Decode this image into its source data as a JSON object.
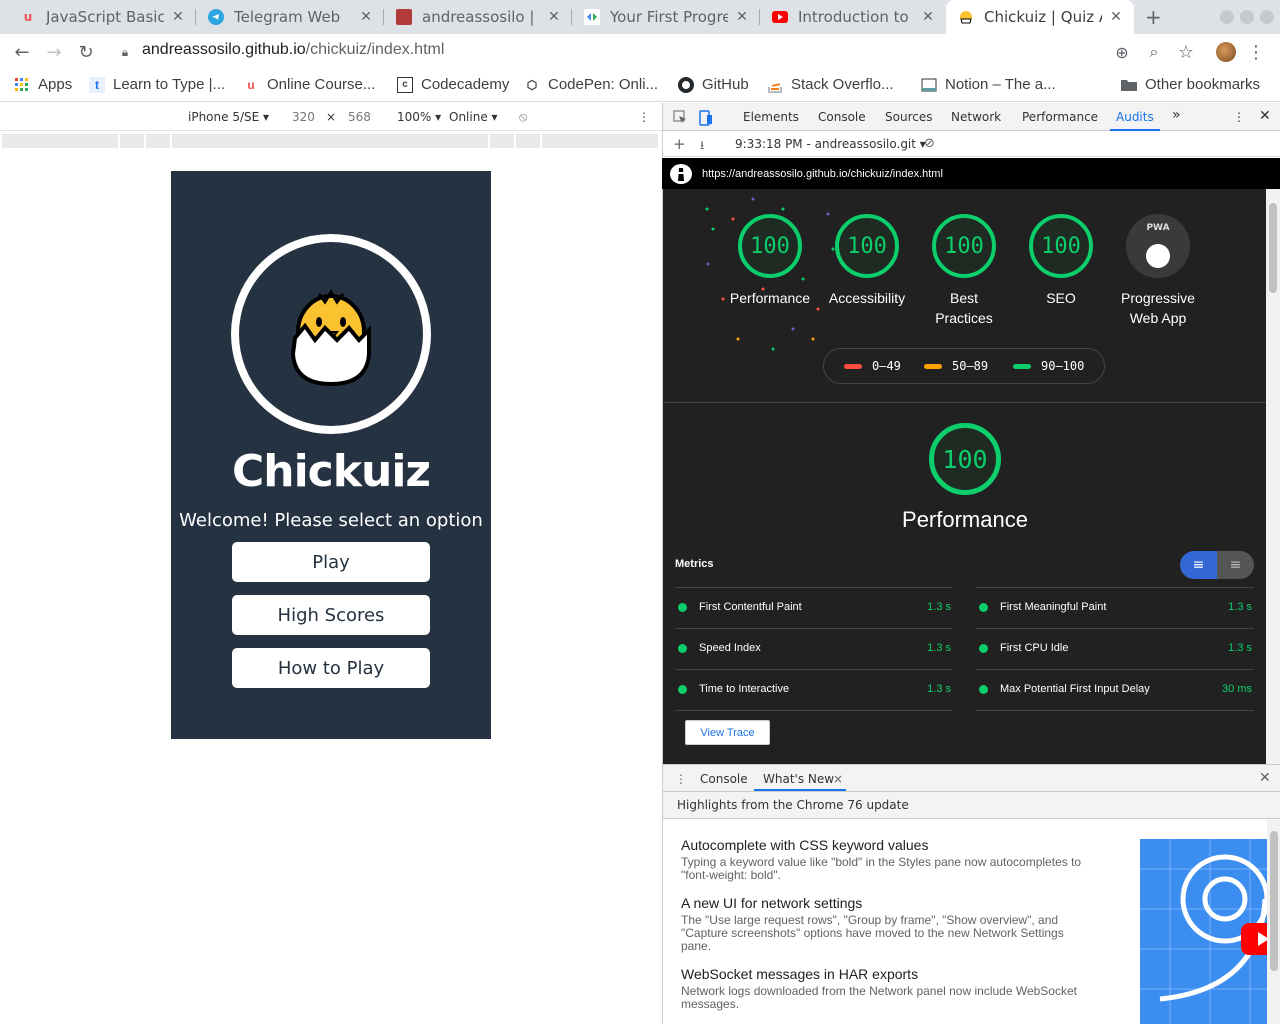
{
  "tabs": [
    {
      "label": "JavaScript Basics",
      "icon": "udemy-icon"
    },
    {
      "label": "Telegram Web",
      "icon": "telegram-icon"
    },
    {
      "label": "andreassosilo | Co",
      "icon": "scrimba-icon"
    },
    {
      "label": "Your First Progres",
      "icon": "google-dev-icon"
    },
    {
      "label": "Introduction to Se",
      "icon": "youtube-icon"
    },
    {
      "label": "Chickuiz | Quiz Ap",
      "icon": "chick-icon",
      "active": true
    }
  ],
  "address": {
    "domain": "andreassosilo.github.io",
    "path": "/chickuiz/index.html"
  },
  "bookmarks": [
    {
      "label": "Apps",
      "icon": "apps-grid-icon"
    },
    {
      "label": "Learn to Type |...",
      "icon": "typing-icon"
    },
    {
      "label": "Online Course...",
      "icon": "udemy-icon"
    },
    {
      "label": "Codecademy",
      "icon": "codecademy-icon"
    },
    {
      "label": "CodePen: Onli...",
      "icon": "codepen-icon"
    },
    {
      "label": "GitHub",
      "icon": "github-icon"
    },
    {
      "label": "Stack Overflo...",
      "icon": "stackoverflow-icon"
    },
    {
      "label": "Notion – The a...",
      "icon": "notion-icon"
    }
  ],
  "other_bookmarks": "Other bookmarks",
  "device_toolbar": {
    "device": "iPhone 5/SE",
    "width": "320",
    "times": "×",
    "height": "568",
    "zoom": "100%",
    "network": "Online"
  },
  "app": {
    "title": "Chickuiz",
    "welcome": "Welcome! Please select an option",
    "buttons": [
      "Play",
      "High Scores",
      "How to Play"
    ]
  },
  "devtools": {
    "tabs": [
      "Elements",
      "Console",
      "Sources",
      "Network",
      "Performance",
      "Audits"
    ],
    "active_tab": "Audits",
    "more": "»",
    "report_selector": "9:33:18 PM - andreassosilo.git",
    "report_url": "https://andreassosilo.github.io/chickuiz/index.html",
    "scores": [
      {
        "label": "Performance",
        "score": "100"
      },
      {
        "label": "Accessibility",
        "score": "100"
      },
      {
        "label": "Best Practices",
        "score": "100"
      },
      {
        "label": "SEO",
        "score": "100"
      }
    ],
    "pwa": {
      "label": "Progressive Web App",
      "badge": "PWA"
    },
    "legend": [
      {
        "range": "0–49",
        "color": "#ff4e42"
      },
      {
        "range": "50–89",
        "color": "#ffa400"
      },
      {
        "range": "90–100",
        "color": "#0cce6b"
      }
    ],
    "performance": {
      "score": "100",
      "label": "Performance"
    },
    "metrics_heading": "Metrics",
    "metrics": [
      {
        "name": "First Contentful Paint",
        "value": "1.3 s"
      },
      {
        "name": "First Meaningful Paint",
        "value": "1.3 s"
      },
      {
        "name": "Speed Index",
        "value": "1.3 s"
      },
      {
        "name": "First CPU Idle",
        "value": "1.3 s"
      },
      {
        "name": "Time to Interactive",
        "value": "1.3 s"
      },
      {
        "name": "Max Potential First Input Delay",
        "value": "30 ms"
      }
    ],
    "view_trace": "View Trace",
    "good_color": "#0cce6b"
  },
  "drawer": {
    "tabs": [
      "Console",
      "What's New"
    ],
    "active_tab": "What's New",
    "close": "×",
    "highlights": "Highlights from the Chrome 76 update",
    "items": [
      {
        "title": "Autocomplete with CSS keyword values",
        "desc": "Typing a keyword value like \"bold\" in the Styles pane now autocompletes to \"font-weight: bold\"."
      },
      {
        "title": "A new UI for network settings",
        "desc": "The \"Use large request rows\", \"Group by frame\", \"Show overview\", and \"Capture screenshots\" options have moved to the new Network Settings pane."
      },
      {
        "title": "WebSocket messages in HAR exports",
        "desc": "Network logs downloaded from the Network panel now include WebSocket messages."
      }
    ]
  }
}
